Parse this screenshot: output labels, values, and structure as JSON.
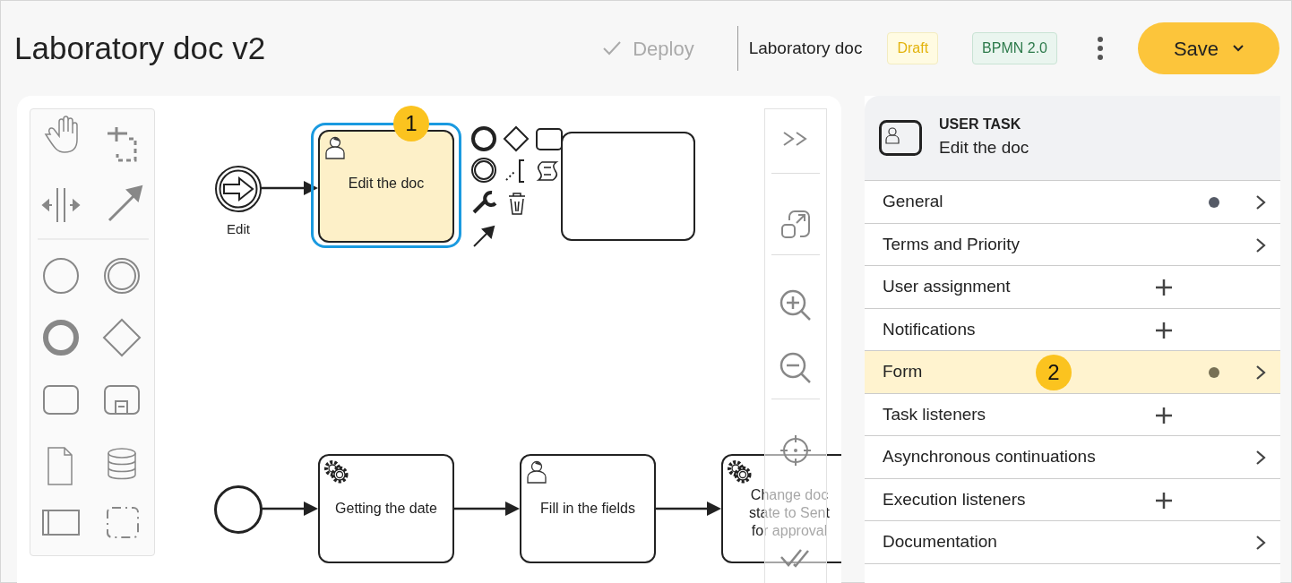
{
  "header": {
    "title": "Laboratory doc v2",
    "deploy": {
      "label": "Deploy",
      "disabled": true
    },
    "doc_name": "Laboratory doc",
    "status_badge": "Draft",
    "format_badge": "BPMN 2.0",
    "save": "Save"
  },
  "diagram": {
    "events": [
      {
        "kind": "message-start",
        "label": "Edit"
      },
      {
        "kind": "start"
      }
    ],
    "tasks": [
      {
        "kind": "user",
        "label": "Edit the doc",
        "selected": true,
        "callout": "1"
      },
      {
        "kind": "empty",
        "selected": false
      },
      {
        "kind": "service",
        "label": "Getting the date",
        "selected": false
      },
      {
        "kind": "user",
        "label": "Fill in the fields",
        "selected": false
      },
      {
        "kind": "service",
        "label": "Change doc state to Sent for approval",
        "selected": false
      }
    ]
  },
  "panel": {
    "type": "USER TASK",
    "name": "Edit the doc",
    "sections": [
      {
        "label": "General",
        "kind": "expand",
        "has_value": true,
        "selected": false
      },
      {
        "label": "Terms and Priority",
        "kind": "expand",
        "has_value": false,
        "selected": false
      },
      {
        "label": "User assignment",
        "kind": "add",
        "has_value": false,
        "selected": false
      },
      {
        "label": "Notifications",
        "kind": "add",
        "has_value": false,
        "selected": false
      },
      {
        "label": "Form",
        "kind": "expand",
        "has_value": true,
        "selected": true,
        "callout": "2"
      },
      {
        "label": "Task listeners",
        "kind": "add",
        "has_value": false,
        "selected": false
      },
      {
        "label": "Asynchronous continuations",
        "kind": "expand",
        "has_value": false,
        "selected": false
      },
      {
        "label": "Execution listeners",
        "kind": "add",
        "has_value": false,
        "selected": false
      },
      {
        "label": "Documentation",
        "kind": "expand",
        "has_value": false,
        "selected": false
      }
    ]
  }
}
